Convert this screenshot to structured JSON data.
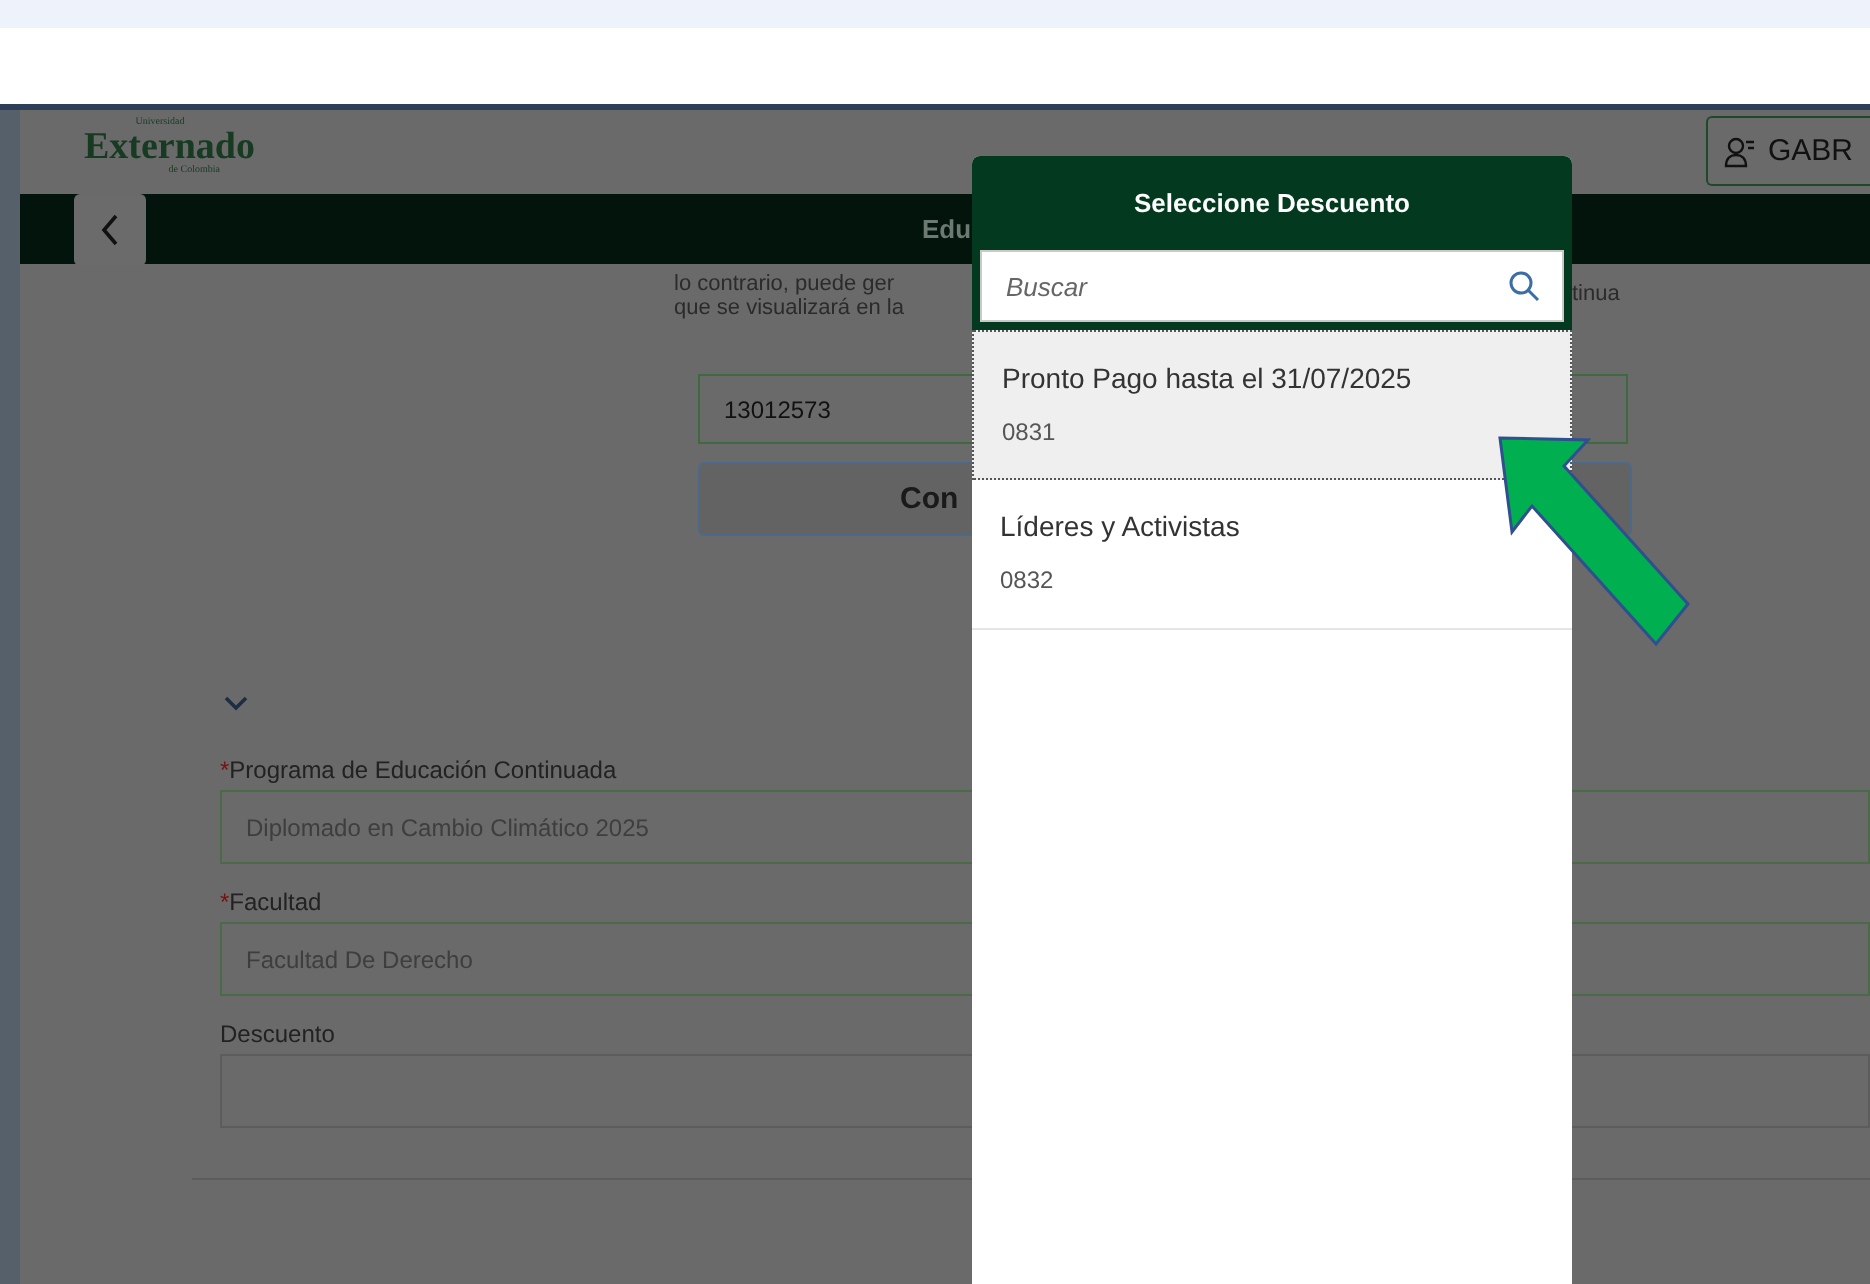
{
  "logo": {
    "top": "Universidad",
    "main": "Externado",
    "bottom": "de Colombia"
  },
  "user_button": {
    "label": "GABR"
  },
  "title_bar": {
    "title": "Edu"
  },
  "intro": {
    "lines": [
      "lo contrario, puede ger",
      "que se visualizará en la"
    ],
    "right_fragment": "tinua"
  },
  "id_field": {
    "value": "13012573"
  },
  "query_button": {
    "label": "Con"
  },
  "form": {
    "fields": [
      {
        "label": "Programa de Educación Continuada",
        "required_mark": "*",
        "value": "Diplomado en Cambio Climático 2025"
      },
      {
        "label": "Facultad",
        "required_mark": "*",
        "value": "Facultad De Derecho"
      },
      {
        "label": "Descuento"
      }
    ]
  },
  "dialog": {
    "title": "Seleccione Descuento",
    "search": {
      "placeholder": "Buscar"
    },
    "items": [
      {
        "title": "Pronto Pago hasta el 31/07/2025",
        "code": "0831",
        "selected": true
      },
      {
        "title": "Líderes y Activistas",
        "code": "0832",
        "selected": false
      }
    ]
  }
}
